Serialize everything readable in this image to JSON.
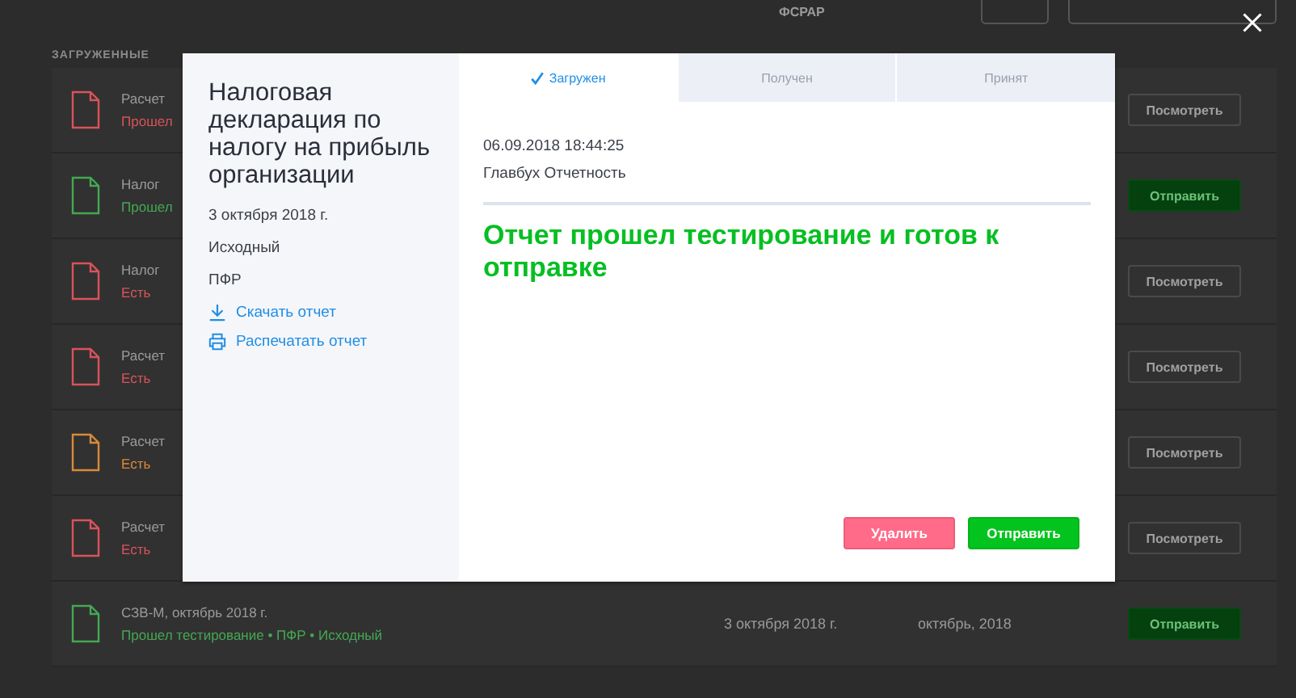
{
  "background": {
    "filter_label": "ФСРАР",
    "section_title": "ЗАГРУЖЕННЫЕ",
    "rows": [
      {
        "title": "Расчет",
        "status": "Прошел",
        "color": "#d9535a",
        "action": {
          "label": "Посмотреть",
          "kind": "view"
        }
      },
      {
        "title": "Налог",
        "status": "Прошел",
        "color": "#44a852",
        "action": {
          "label": "Отправить",
          "kind": "send"
        }
      },
      {
        "title": "Налог",
        "status": "Есть",
        "color": "#d9535a",
        "action": {
          "label": "Посмотреть",
          "kind": "view"
        }
      },
      {
        "title": "Расчет",
        "status": "Есть",
        "color": "#d9535a",
        "action": {
          "label": "Посмотреть",
          "kind": "view"
        }
      },
      {
        "title": "Расчет",
        "status": "Есть",
        "color": "#d98a3a",
        "action": {
          "label": "Посмотреть",
          "kind": "view"
        }
      },
      {
        "title": "Расчет",
        "status": "Есть",
        "color": "#d9535a",
        "action": {
          "label": "Посмотреть",
          "kind": "view"
        }
      },
      {
        "title": "СЗВ-М, октябрь 2018 г.",
        "status": "Прошел тестирование • ПФР • Исходный",
        "color": "#44a852",
        "date": "3 октября 2018 г.",
        "period": "октябрь, 2018",
        "action": {
          "label": "Отправить",
          "kind": "send"
        }
      }
    ]
  },
  "modal": {
    "title": "Налоговая декларация по налогу на прибыль организации",
    "date": "3 октября 2018 г.",
    "correction": "Исходный",
    "agency": "ПФР",
    "links": [
      {
        "label": "Скачать отчет",
        "kind": "download"
      },
      {
        "label": "Распечатать отчет",
        "kind": "print"
      }
    ],
    "tabs": [
      {
        "label": "Загружен",
        "selected": true
      },
      {
        "label": "Получен",
        "selected": false
      },
      {
        "label": "Принят",
        "selected": false
      }
    ],
    "timestamp": "06.09.2018 18:44:25",
    "author": "Главбух Отчетность",
    "message": "Отчет прошел тестирование и готов к отправке",
    "buttons": [
      {
        "label": "Удалить",
        "kind": "danger"
      },
      {
        "label": "Отправить",
        "kind": "primary"
      }
    ]
  }
}
